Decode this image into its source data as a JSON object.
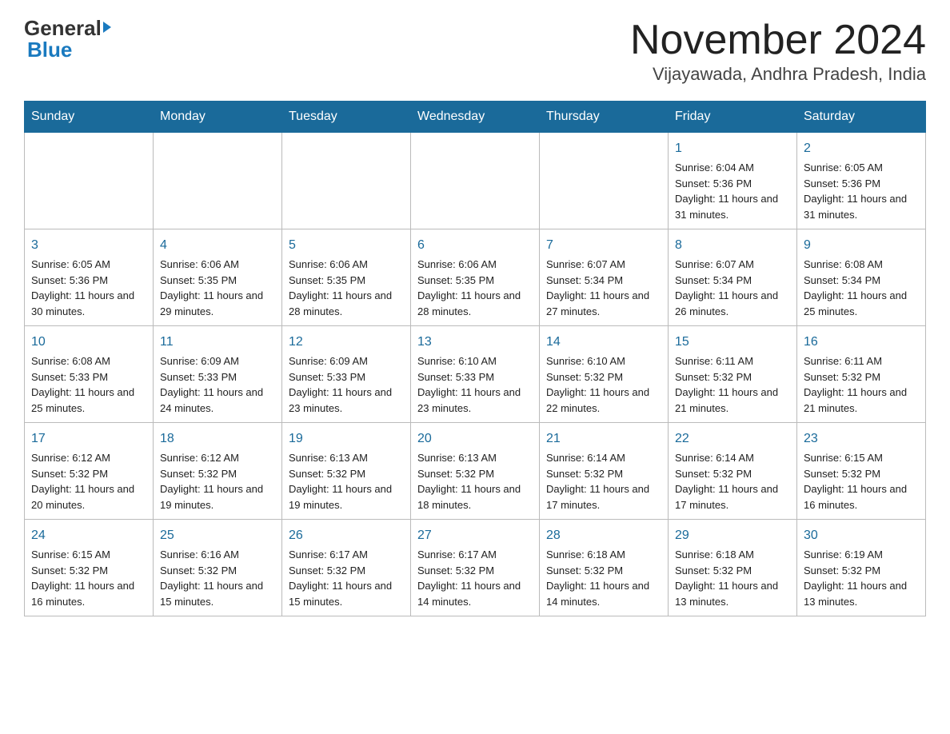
{
  "header": {
    "logo_general": "General",
    "logo_blue": "Blue",
    "month_title": "November 2024",
    "location": "Vijayawada, Andhra Pradesh, India"
  },
  "days_of_week": [
    "Sunday",
    "Monday",
    "Tuesday",
    "Wednesday",
    "Thursday",
    "Friday",
    "Saturday"
  ],
  "weeks": [
    [
      {
        "day": "",
        "sunrise": "",
        "sunset": "",
        "daylight": ""
      },
      {
        "day": "",
        "sunrise": "",
        "sunset": "",
        "daylight": ""
      },
      {
        "day": "",
        "sunrise": "",
        "sunset": "",
        "daylight": ""
      },
      {
        "day": "",
        "sunrise": "",
        "sunset": "",
        "daylight": ""
      },
      {
        "day": "",
        "sunrise": "",
        "sunset": "",
        "daylight": ""
      },
      {
        "day": "1",
        "sunrise": "Sunrise: 6:04 AM",
        "sunset": "Sunset: 5:36 PM",
        "daylight": "Daylight: 11 hours and 31 minutes."
      },
      {
        "day": "2",
        "sunrise": "Sunrise: 6:05 AM",
        "sunset": "Sunset: 5:36 PM",
        "daylight": "Daylight: 11 hours and 31 minutes."
      }
    ],
    [
      {
        "day": "3",
        "sunrise": "Sunrise: 6:05 AM",
        "sunset": "Sunset: 5:36 PM",
        "daylight": "Daylight: 11 hours and 30 minutes."
      },
      {
        "day": "4",
        "sunrise": "Sunrise: 6:06 AM",
        "sunset": "Sunset: 5:35 PM",
        "daylight": "Daylight: 11 hours and 29 minutes."
      },
      {
        "day": "5",
        "sunrise": "Sunrise: 6:06 AM",
        "sunset": "Sunset: 5:35 PM",
        "daylight": "Daylight: 11 hours and 28 minutes."
      },
      {
        "day": "6",
        "sunrise": "Sunrise: 6:06 AM",
        "sunset": "Sunset: 5:35 PM",
        "daylight": "Daylight: 11 hours and 28 minutes."
      },
      {
        "day": "7",
        "sunrise": "Sunrise: 6:07 AM",
        "sunset": "Sunset: 5:34 PM",
        "daylight": "Daylight: 11 hours and 27 minutes."
      },
      {
        "day": "8",
        "sunrise": "Sunrise: 6:07 AM",
        "sunset": "Sunset: 5:34 PM",
        "daylight": "Daylight: 11 hours and 26 minutes."
      },
      {
        "day": "9",
        "sunrise": "Sunrise: 6:08 AM",
        "sunset": "Sunset: 5:34 PM",
        "daylight": "Daylight: 11 hours and 25 minutes."
      }
    ],
    [
      {
        "day": "10",
        "sunrise": "Sunrise: 6:08 AM",
        "sunset": "Sunset: 5:33 PM",
        "daylight": "Daylight: 11 hours and 25 minutes."
      },
      {
        "day": "11",
        "sunrise": "Sunrise: 6:09 AM",
        "sunset": "Sunset: 5:33 PM",
        "daylight": "Daylight: 11 hours and 24 minutes."
      },
      {
        "day": "12",
        "sunrise": "Sunrise: 6:09 AM",
        "sunset": "Sunset: 5:33 PM",
        "daylight": "Daylight: 11 hours and 23 minutes."
      },
      {
        "day": "13",
        "sunrise": "Sunrise: 6:10 AM",
        "sunset": "Sunset: 5:33 PM",
        "daylight": "Daylight: 11 hours and 23 minutes."
      },
      {
        "day": "14",
        "sunrise": "Sunrise: 6:10 AM",
        "sunset": "Sunset: 5:32 PM",
        "daylight": "Daylight: 11 hours and 22 minutes."
      },
      {
        "day": "15",
        "sunrise": "Sunrise: 6:11 AM",
        "sunset": "Sunset: 5:32 PM",
        "daylight": "Daylight: 11 hours and 21 minutes."
      },
      {
        "day": "16",
        "sunrise": "Sunrise: 6:11 AM",
        "sunset": "Sunset: 5:32 PM",
        "daylight": "Daylight: 11 hours and 21 minutes."
      }
    ],
    [
      {
        "day": "17",
        "sunrise": "Sunrise: 6:12 AM",
        "sunset": "Sunset: 5:32 PM",
        "daylight": "Daylight: 11 hours and 20 minutes."
      },
      {
        "day": "18",
        "sunrise": "Sunrise: 6:12 AM",
        "sunset": "Sunset: 5:32 PM",
        "daylight": "Daylight: 11 hours and 19 minutes."
      },
      {
        "day": "19",
        "sunrise": "Sunrise: 6:13 AM",
        "sunset": "Sunset: 5:32 PM",
        "daylight": "Daylight: 11 hours and 19 minutes."
      },
      {
        "day": "20",
        "sunrise": "Sunrise: 6:13 AM",
        "sunset": "Sunset: 5:32 PM",
        "daylight": "Daylight: 11 hours and 18 minutes."
      },
      {
        "day": "21",
        "sunrise": "Sunrise: 6:14 AM",
        "sunset": "Sunset: 5:32 PM",
        "daylight": "Daylight: 11 hours and 17 minutes."
      },
      {
        "day": "22",
        "sunrise": "Sunrise: 6:14 AM",
        "sunset": "Sunset: 5:32 PM",
        "daylight": "Daylight: 11 hours and 17 minutes."
      },
      {
        "day": "23",
        "sunrise": "Sunrise: 6:15 AM",
        "sunset": "Sunset: 5:32 PM",
        "daylight": "Daylight: 11 hours and 16 minutes."
      }
    ],
    [
      {
        "day": "24",
        "sunrise": "Sunrise: 6:15 AM",
        "sunset": "Sunset: 5:32 PM",
        "daylight": "Daylight: 11 hours and 16 minutes."
      },
      {
        "day": "25",
        "sunrise": "Sunrise: 6:16 AM",
        "sunset": "Sunset: 5:32 PM",
        "daylight": "Daylight: 11 hours and 15 minutes."
      },
      {
        "day": "26",
        "sunrise": "Sunrise: 6:17 AM",
        "sunset": "Sunset: 5:32 PM",
        "daylight": "Daylight: 11 hours and 15 minutes."
      },
      {
        "day": "27",
        "sunrise": "Sunrise: 6:17 AM",
        "sunset": "Sunset: 5:32 PM",
        "daylight": "Daylight: 11 hours and 14 minutes."
      },
      {
        "day": "28",
        "sunrise": "Sunrise: 6:18 AM",
        "sunset": "Sunset: 5:32 PM",
        "daylight": "Daylight: 11 hours and 14 minutes."
      },
      {
        "day": "29",
        "sunrise": "Sunrise: 6:18 AM",
        "sunset": "Sunset: 5:32 PM",
        "daylight": "Daylight: 11 hours and 13 minutes."
      },
      {
        "day": "30",
        "sunrise": "Sunrise: 6:19 AM",
        "sunset": "Sunset: 5:32 PM",
        "daylight": "Daylight: 11 hours and 13 minutes."
      }
    ]
  ]
}
